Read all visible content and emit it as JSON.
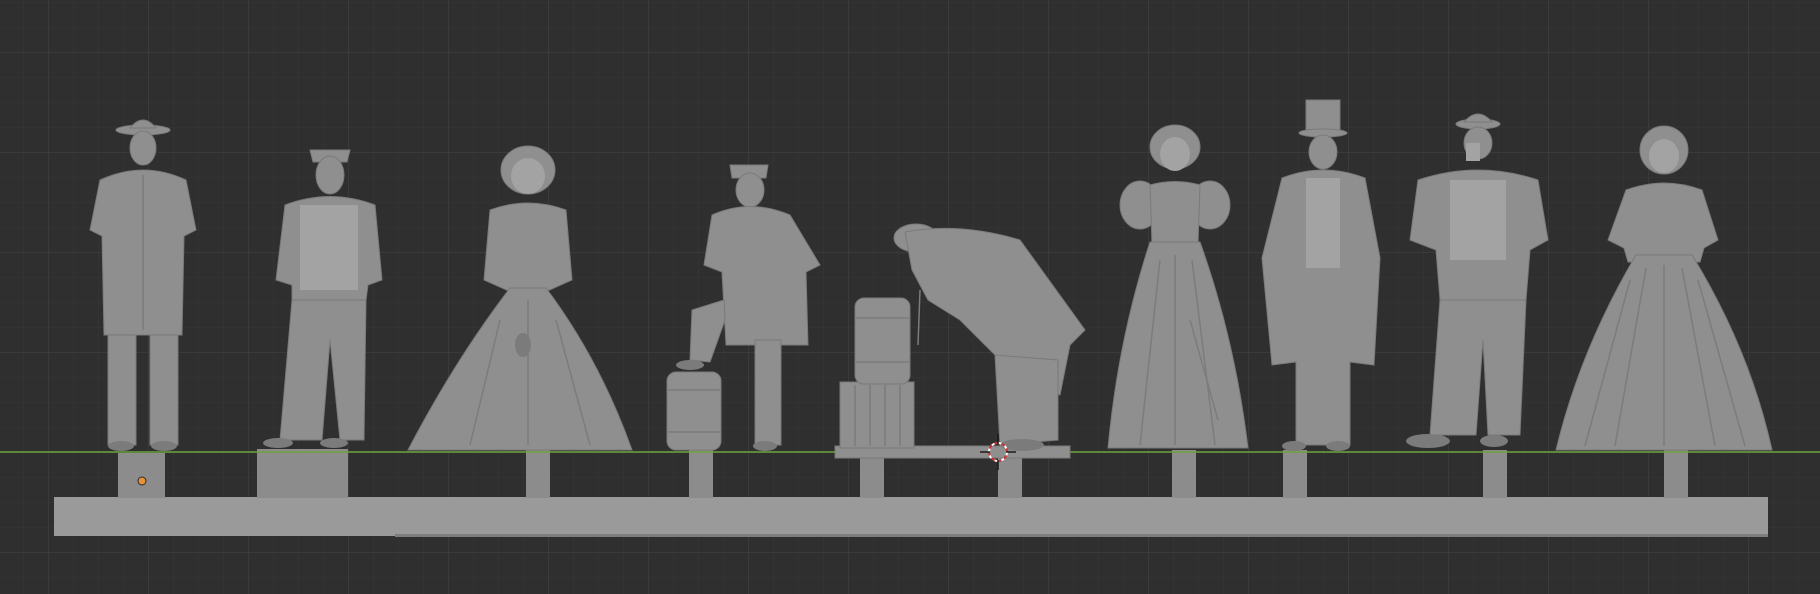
{
  "viewport": {
    "grid_color": "#3a3a3a",
    "background_color": "#2f2f2f",
    "floor_axis_color": "#6ea33a"
  },
  "figures": [
    {
      "name": "soldier-long-coat"
    },
    {
      "name": "bearded-man-vest"
    },
    {
      "name": "woman-bonnet-hoop-dress"
    },
    {
      "name": "soldier-foot-on-barrel"
    },
    {
      "name": "man-bending-at-barrel"
    },
    {
      "name": "woman-puff-sleeves-umbrella"
    },
    {
      "name": "man-top-hat"
    },
    {
      "name": "man-bowler-drinking"
    },
    {
      "name": "woman-bonnet-waving"
    }
  ],
  "markers": {
    "origin": "origin-dot-icon",
    "cursor": "3d-cursor-icon"
  }
}
